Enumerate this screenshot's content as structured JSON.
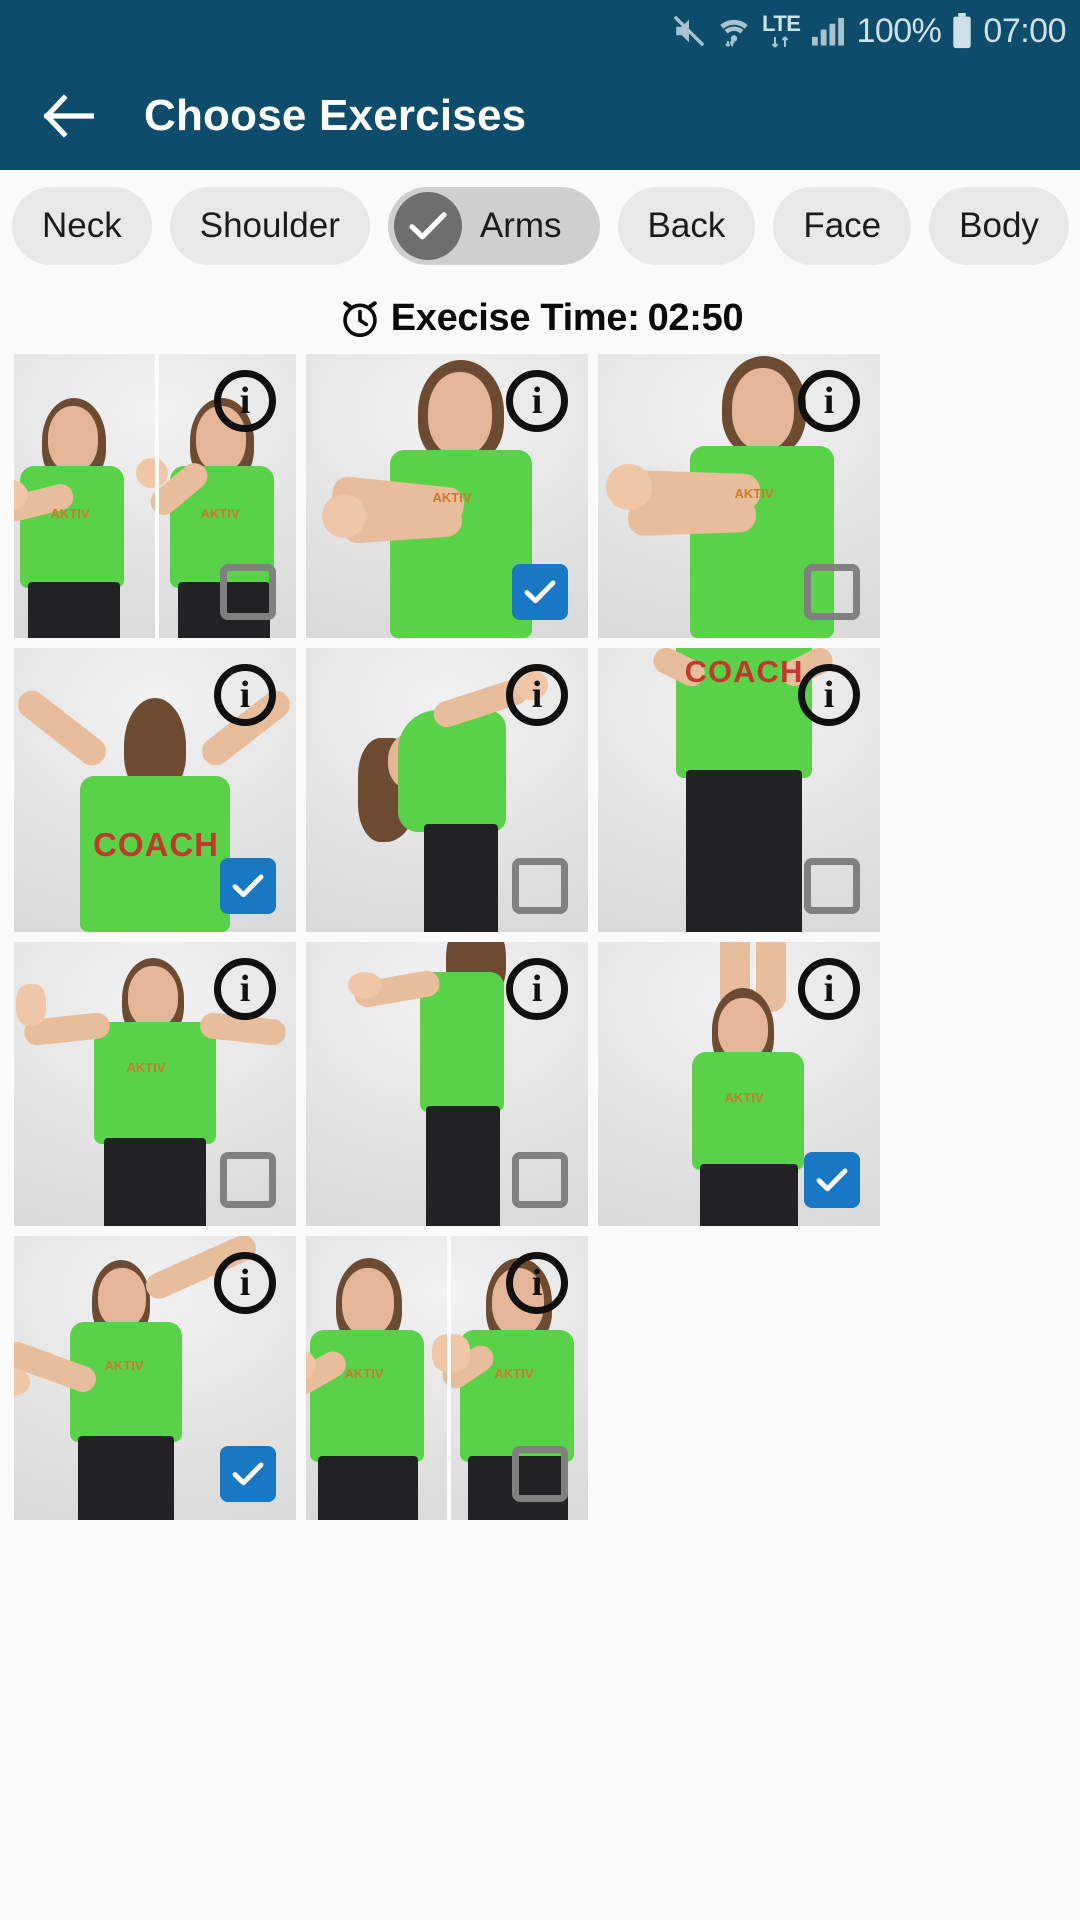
{
  "statusbar": {
    "icons": [
      "mute-icon",
      "wifi-icon",
      "lte-icon",
      "signal-icon",
      "battery-icon"
    ],
    "battery_percent": "100%",
    "clock": "07:00",
    "network_label": "LTE"
  },
  "appbar": {
    "back_icon": "back-arrow-icon",
    "title": "Choose Exercises",
    "bg_color": "#0d4c6b"
  },
  "chips": [
    {
      "label": "Neck",
      "selected": false
    },
    {
      "label": "Shoulder",
      "selected": false
    },
    {
      "label": "Arms",
      "selected": true
    },
    {
      "label": "Back",
      "selected": false
    },
    {
      "label": "Face",
      "selected": false
    },
    {
      "label": "Body",
      "selected": false
    }
  ],
  "timer": {
    "icon": "alarm-clock-icon",
    "label": "Execise Time:",
    "value": "02:50"
  },
  "colors": {
    "header": "#0d4c6b",
    "checkbox_checked": "#1878c4",
    "checkbox_unchecked_border": "#808080",
    "chip_bg": "#e8e8e8",
    "chip_selected_bg": "#cfcfcf",
    "chip_check_circle": "#6e6e6e",
    "page_bg": "#fafafa",
    "shirt_green": "#59d24a",
    "coach_red": "#c0392b"
  },
  "exercises": [
    {
      "index": 1,
      "checked": false,
      "info": "i",
      "shirt_text": "",
      "pose": "two-panel-wrist-flex"
    },
    {
      "index": 2,
      "checked": true,
      "info": "i",
      "shirt_text": "",
      "pose": "cross-body-arm-stretch"
    },
    {
      "index": 3,
      "checked": false,
      "info": "i",
      "shirt_text": "",
      "pose": "forearm-clasp-front"
    },
    {
      "index": 4,
      "checked": true,
      "info": "i",
      "shirt_text": "COACH",
      "pose": "arms-overhead-v-back"
    },
    {
      "index": 5,
      "checked": false,
      "info": "i",
      "shirt_text": "",
      "pose": "bend-forward-overhead"
    },
    {
      "index": 6,
      "checked": false,
      "info": "i",
      "shirt_text": "COACH",
      "pose": "hands-behind-back"
    },
    {
      "index": 7,
      "checked": false,
      "info": "i",
      "shirt_text": "",
      "pose": "arms-out-goalpost"
    },
    {
      "index": 8,
      "checked": false,
      "info": "i",
      "shirt_text": "",
      "pose": "side-profile-arm-across"
    },
    {
      "index": 9,
      "checked": true,
      "info": "i",
      "shirt_text": "",
      "pose": "both-arms-overhead"
    },
    {
      "index": 10,
      "checked": true,
      "info": "i",
      "shirt_text": "",
      "pose": "one-arm-up-one-down"
    },
    {
      "index": 11,
      "checked": false,
      "info": "i",
      "shirt_text": "",
      "pose": "two-panel-open-hands"
    }
  ]
}
